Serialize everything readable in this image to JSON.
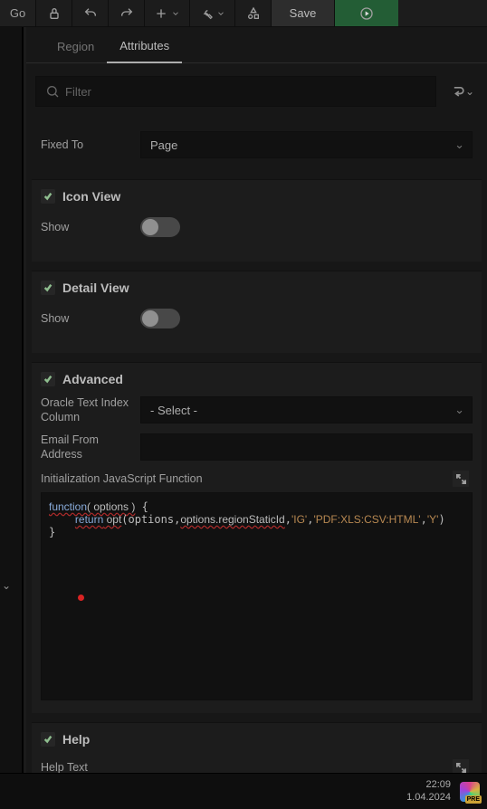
{
  "toolbar": {
    "go_label": "Go",
    "save_label": "Save"
  },
  "tabs": {
    "region": "Region",
    "attributes": "Attributes"
  },
  "filter": {
    "placeholder": "Filter"
  },
  "fixed_to": {
    "label": "Fixed To",
    "value": "Page"
  },
  "icon_view": {
    "title": "Icon View",
    "show_label": "Show"
  },
  "detail_view": {
    "title": "Detail View",
    "show_label": "Show"
  },
  "advanced": {
    "title": "Advanced",
    "oracle_text_label": "Oracle Text Index Column",
    "oracle_text_value": "- Select -",
    "email_from_label": "Email From Address",
    "init_js_label": "Initialization JavaScript Function",
    "init_js_code": "function( options ) {\n    return opt(options,options.regionStaticId,'IG','PDF:XLS:CSV:HTML','Y')\n}"
  },
  "help": {
    "title": "Help",
    "help_text_label": "Help Text"
  },
  "taskbar": {
    "time": "22:09",
    "date": "1.04.2024",
    "tray_badge": "PRE"
  }
}
